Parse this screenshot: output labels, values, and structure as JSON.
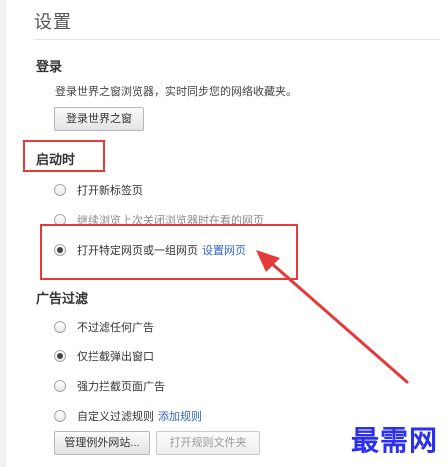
{
  "page": {
    "title": "设置"
  },
  "login": {
    "heading": "登录",
    "description": "登录世界之窗浏览器，实时同步您的网络收藏夹。",
    "button_label": "登录世界之窗"
  },
  "startup": {
    "heading": "启动时",
    "options": [
      {
        "label": "打开新标签页",
        "checked": false
      },
      {
        "label": "继续浏览上次关闭浏览器时在看的网页",
        "checked": false
      },
      {
        "label": "打开特定网页或一组网页",
        "checked": true,
        "link": "设置网页"
      }
    ]
  },
  "adfilter": {
    "heading": "广告过滤",
    "options": [
      {
        "label": "不过滤任何广告",
        "checked": false
      },
      {
        "label": "仅拦截弹出窗口",
        "checked": true
      },
      {
        "label": "强力拦截页面广告",
        "checked": false
      },
      {
        "label": "自定义过滤规则",
        "checked": false,
        "link": "添加规则"
      }
    ],
    "buttons": {
      "manage_label": "管理例外网站...",
      "open_rules_label": "打开规则文件夹"
    }
  },
  "annotations": {
    "highlight_color": "#e43a3a",
    "arrow_color": "#e43a3a"
  },
  "watermark": {
    "text": "最需网",
    "color": "#2a2ff0"
  }
}
